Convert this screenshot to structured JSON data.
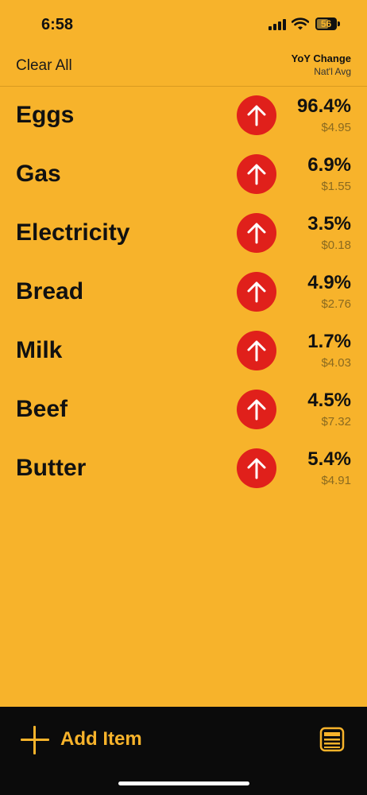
{
  "status": {
    "time": "6:58",
    "battery": "56"
  },
  "header": {
    "clear_all": "Clear All",
    "column_title": "YoY Change",
    "column_subtitle": "Nat'l Avg"
  },
  "items": [
    {
      "name": "Eggs",
      "change": "96.4%",
      "price": "$4.95",
      "direction": "up"
    },
    {
      "name": "Gas",
      "change": "6.9%",
      "price": "$1.55",
      "direction": "up"
    },
    {
      "name": "Electricity",
      "change": "3.5%",
      "price": "$0.18",
      "direction": "up"
    },
    {
      "name": "Bread",
      "change": "4.9%",
      "price": "$2.76",
      "direction": "up"
    },
    {
      "name": "Milk",
      "change": "1.7%",
      "price": "$4.03",
      "direction": "up"
    },
    {
      "name": "Beef",
      "change": "4.5%",
      "price": "$7.32",
      "direction": "up"
    },
    {
      "name": "Butter",
      "change": "5.4%",
      "price": "$4.91",
      "direction": "up"
    }
  ],
  "footer": {
    "add_label": "Add Item"
  },
  "colors": {
    "background": "#F7B32B",
    "up_arrow": "#E0201B",
    "footer": "#0b0b0b"
  }
}
